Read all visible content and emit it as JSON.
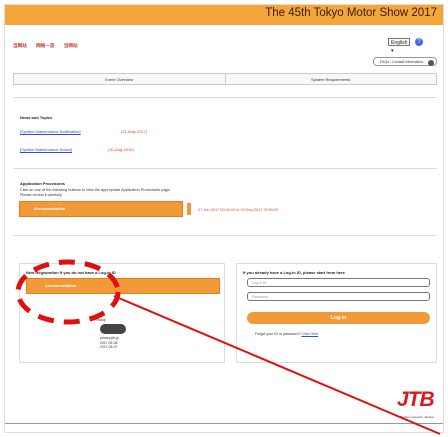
{
  "banner": {
    "title": "The 45th Tokyo Motor Show 2017"
  },
  "top_nav": {
    "items": [
      "当网站",
      "网络一览",
      "当网站"
    ]
  },
  "header_tools": {
    "language_label": "English",
    "help_icon": "question-icon",
    "faq_label": "FAQs / Contact Information"
  },
  "tabs": [
    {
      "label": "Event Overview"
    },
    {
      "label": "System Requirements"
    }
  ],
  "news": {
    "title": "News and Topics",
    "items": [
      {
        "link": "[System Maintenance Notification]",
        "date": "(21-May-2017)"
      },
      {
        "link": "[System Maintenance Notice]",
        "date": "(30-Aug-2016)"
      }
    ]
  },
  "application": {
    "title": "Application Procedures",
    "description_1": "Click on one of the following buttons to view the appropriate Application Procedures page.",
    "description_2": "Please review it carefully.",
    "accommodation_button": "Accommodation",
    "period": "27-Jun-2017 00:00:00 to 29-Sep-2017 23:59:00"
  },
  "new_registration": {
    "title": "New Registration If you do not have a Log-in ID",
    "button": "Accommodation",
    "privacy_label": "Privacy",
    "badge_text": [
      "privacy.jtb.jp",
      "2017-05-08",
      "2017-05-07"
    ]
  },
  "login": {
    "title": "If you already have a Log-in ID, please start from here",
    "login_id_placeholder": "Log-in ID",
    "password_placeholder": "Password",
    "button": "Log-in",
    "forgot_text": "Forgot your ID or password?",
    "forgot_link": "Click Here"
  },
  "footer": {
    "logo": "JTB",
    "tagline": "Perfect moments, always."
  },
  "colors": {
    "accent": "#f39a38",
    "banner": "#f4a63a",
    "link": "#2a4bd7",
    "date": "#dd4433",
    "annotation": "#e01010",
    "logo": "#d91b1b"
  }
}
